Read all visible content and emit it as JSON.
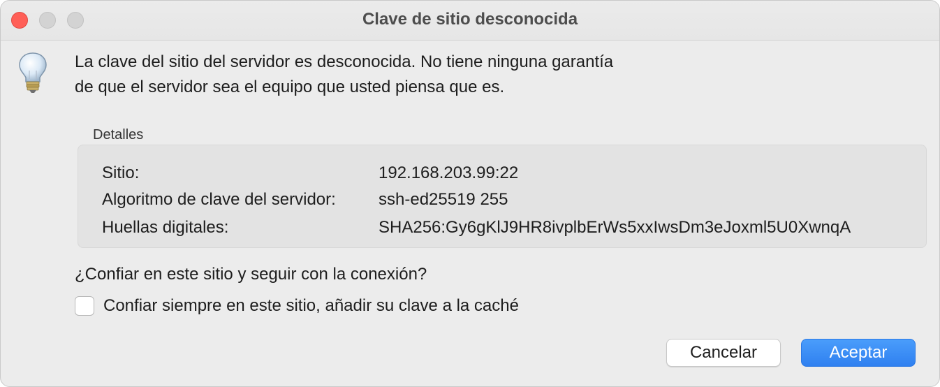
{
  "window": {
    "title": "Clave de sitio desconocida"
  },
  "message": "La clave del sitio del servidor es desconocida. No tiene ninguna garantía de que el servidor sea el equipo que usted piensa que es.",
  "details": {
    "label": "Detalles",
    "rows": [
      {
        "key": "Sitio:",
        "value": "192.168.203.99:22"
      },
      {
        "key": "Algoritmo de clave del servidor:",
        "value": "ssh-ed25519 255"
      },
      {
        "key": "Huellas digitales:",
        "value": "SHA256:Gy6gKlJ9HR8ivplbErWs5xxIwsDm3eJoxml5U0XwnqA"
      }
    ]
  },
  "question": "¿Confiar en este sitio y seguir con la conexión?",
  "checkbox": {
    "label": "Confiar siempre en este sitio, añadir su clave a la caché",
    "checked": false
  },
  "buttons": {
    "cancel": "Cancelar",
    "accept": "Aceptar"
  },
  "icons": {
    "dialog_icon": "lightbulb-icon"
  },
  "colors": {
    "close": "#ff5f57",
    "accent": "#2f80f0"
  }
}
